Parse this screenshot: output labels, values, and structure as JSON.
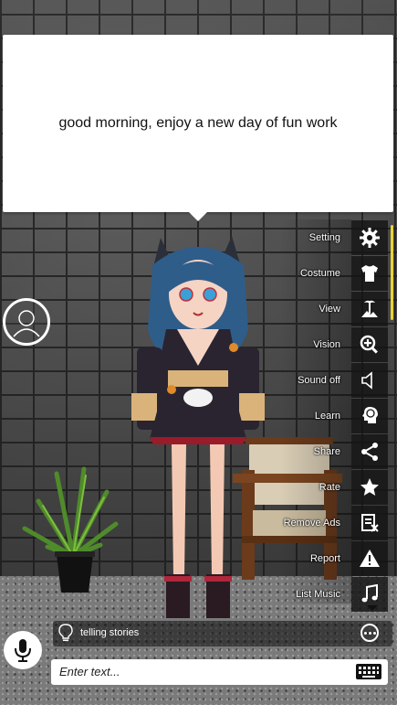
{
  "speech": {
    "text": "good morning, enjoy a new day of fun work"
  },
  "menu": {
    "items": [
      {
        "label": "Setting",
        "icon": "gear-icon"
      },
      {
        "label": "Costume",
        "icon": "shirt-icon"
      },
      {
        "label": "View",
        "icon": "scenery-icon"
      },
      {
        "label": "Vision",
        "icon": "zoom-in-icon"
      },
      {
        "label": "Sound off",
        "icon": "speaker-icon"
      },
      {
        "label": "Learn",
        "icon": "brain-head-icon"
      },
      {
        "label": "Share",
        "icon": "share-icon"
      },
      {
        "label": "Rate",
        "icon": "star-icon"
      },
      {
        "label": "Remove Ads",
        "icon": "remove-ads-icon"
      },
      {
        "label": "Report",
        "icon": "warning-icon"
      },
      {
        "label": "List Music",
        "icon": "music-note-icon"
      }
    ]
  },
  "suggestion": {
    "text": "telling stories",
    "icon": "lightbulb-icon"
  },
  "input": {
    "placeholder": "Enter text..."
  },
  "colors": {
    "accent": "#e8d33a",
    "tile": "#141414",
    "bubble": "#ffffff"
  }
}
